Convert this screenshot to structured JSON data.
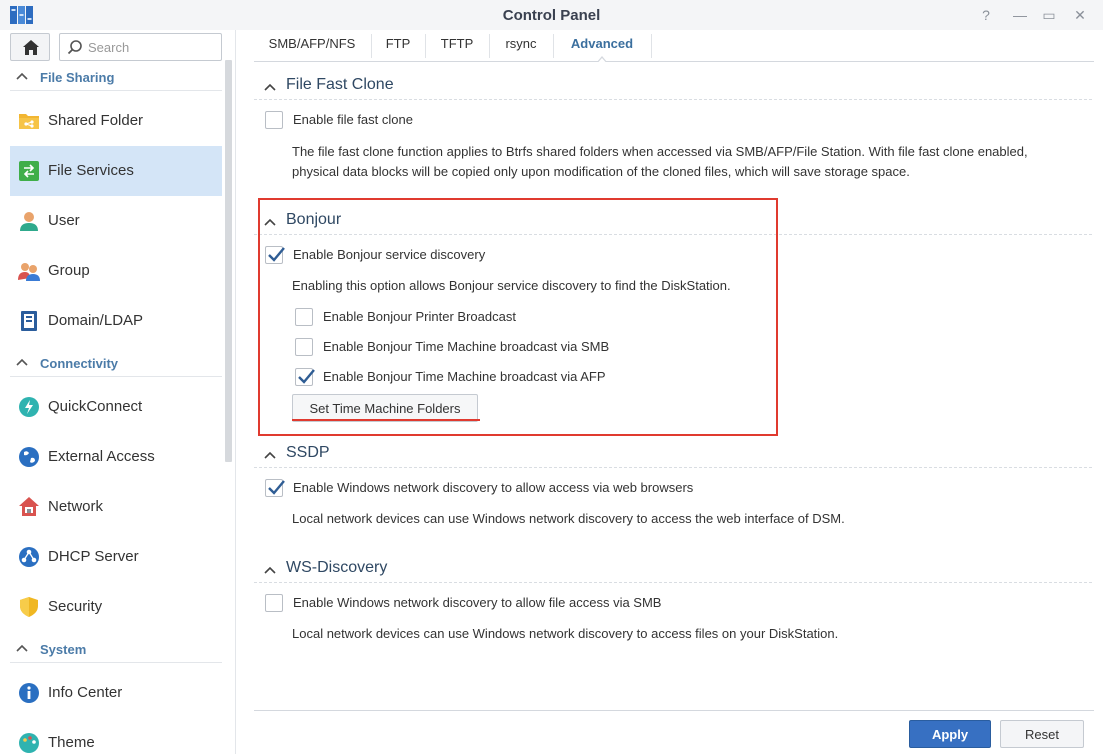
{
  "window": {
    "title": "Control Panel",
    "controls": [
      "?",
      "—",
      "▭",
      "✕"
    ]
  },
  "sidebar": {
    "search_placeholder": "Search",
    "sections": [
      {
        "label": "File Sharing"
      },
      {
        "label": "Connectivity"
      },
      {
        "label": "System"
      }
    ],
    "items": [
      {
        "label": "Shared Folder",
        "icon": "shared-folder-icon"
      },
      {
        "label": "File Services",
        "icon": "file-services-icon",
        "active": true
      },
      {
        "label": "User",
        "icon": "user-icon"
      },
      {
        "label": "Group",
        "icon": "group-icon"
      },
      {
        "label": "Domain/LDAP",
        "icon": "domain-ldap-icon"
      },
      {
        "label": "QuickConnect",
        "icon": "quickconnect-icon"
      },
      {
        "label": "External Access",
        "icon": "external-access-icon"
      },
      {
        "label": "Network",
        "icon": "network-icon"
      },
      {
        "label": "DHCP Server",
        "icon": "dhcp-server-icon"
      },
      {
        "label": "Security",
        "icon": "security-icon"
      },
      {
        "label": "Info Center",
        "icon": "info-center-icon"
      },
      {
        "label": "Theme",
        "icon": "theme-icon"
      }
    ]
  },
  "tabs": [
    {
      "label": "SMB/AFP/NFS"
    },
    {
      "label": "FTP"
    },
    {
      "label": "TFTP"
    },
    {
      "label": "rsync"
    },
    {
      "label": "Advanced",
      "active": true
    }
  ],
  "content": {
    "file_fast_clone": {
      "title": "File Fast Clone",
      "checkbox": {
        "label": "Enable file fast clone",
        "checked": false
      },
      "desc_line1": "The file fast clone function applies to Btrfs shared folders when accessed via SMB/AFP/File Station. With file fast clone enabled,",
      "desc_line2": "physical data blocks will be copied only upon modification of the cloned files, which will save storage space."
    },
    "bonjour": {
      "title": "Bonjour",
      "checkbox": {
        "label": "Enable Bonjour service discovery",
        "checked": true
      },
      "desc": "Enabling this option allows Bonjour service discovery to find the DiskStation.",
      "sub_options": [
        {
          "label": "Enable Bonjour Printer Broadcast",
          "checked": false
        },
        {
          "label": "Enable Bonjour Time Machine broadcast via SMB",
          "checked": false
        },
        {
          "label": "Enable Bonjour Time Machine broadcast via AFP",
          "checked": true
        }
      ],
      "button": "Set Time Machine Folders"
    },
    "ssdp": {
      "title": "SSDP",
      "checkbox": {
        "label": "Enable Windows network discovery to allow access via web browsers",
        "checked": true
      },
      "desc": "Local network devices can use Windows network discovery to access the web interface of DSM."
    },
    "ws_discovery": {
      "title": "WS-Discovery",
      "checkbox": {
        "label": "Enable Windows network discovery to allow file access via SMB",
        "checked": false
      },
      "desc": "Local network devices can use Windows network discovery to access files on your DiskStation."
    }
  },
  "footer": {
    "apply": "Apply",
    "reset": "Reset"
  },
  "colors": {
    "accent": "#3770c2",
    "highlight": "#e03a2f",
    "section_label": "#4b7ba8",
    "active_item": "#d4e5f7"
  }
}
